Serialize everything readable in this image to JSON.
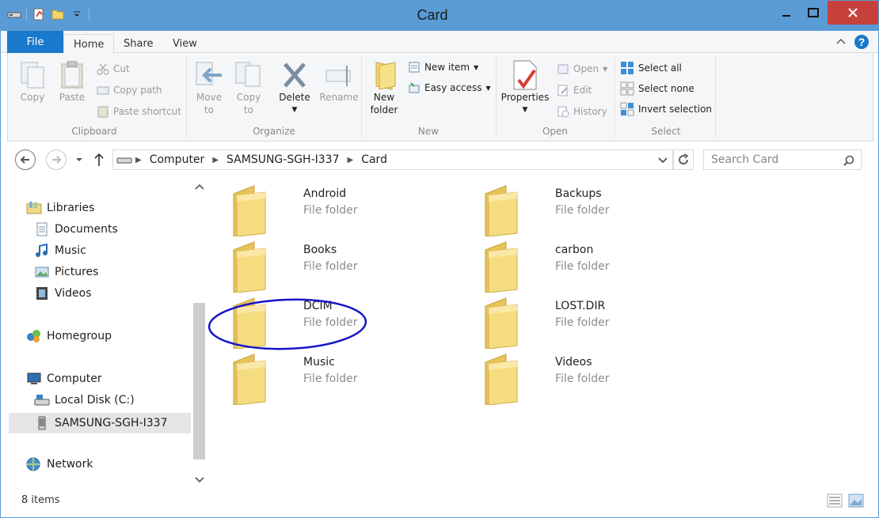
{
  "window": {
    "title": "Card"
  },
  "ribbon": {
    "tabs": {
      "file": "File",
      "home": "Home",
      "share": "Share",
      "view": "View"
    },
    "clipboard": {
      "label": "Clipboard",
      "copy": "Copy",
      "paste": "Paste",
      "cut": "Cut",
      "copy_path": "Copy path",
      "paste_shortcut": "Paste shortcut"
    },
    "organize": {
      "label": "Organize",
      "move_to_1": "Move",
      "move_to_2": "to",
      "copy_to_1": "Copy",
      "copy_to_2": "to",
      "delete": "Delete",
      "rename": "Rename"
    },
    "new": {
      "label": "New",
      "new_folder_1": "New",
      "new_folder_2": "folder",
      "new_item": "New item",
      "easy_access": "Easy access"
    },
    "open": {
      "label": "Open",
      "properties": "Properties",
      "open": "Open",
      "edit": "Edit",
      "history": "History"
    },
    "select": {
      "label": "Select",
      "select_all": "Select all",
      "select_none": "Select none",
      "invert_selection": "Invert selection"
    }
  },
  "address": {
    "crumbs": [
      "Computer",
      "SAMSUNG-SGH-I337",
      "Card"
    ],
    "search_placeholder": "Search Card"
  },
  "nav": {
    "libraries": "Libraries",
    "documents": "Documents",
    "music": "Music",
    "pictures": "Pictures",
    "videos": "Videos",
    "homegroup": "Homegroup",
    "computer": "Computer",
    "local_disk": "Local Disk (C:)",
    "samsung": "SAMSUNG-SGH-I337",
    "network": "Network"
  },
  "files": [
    {
      "name": "Android",
      "type": "File folder"
    },
    {
      "name": "Backups",
      "type": "File folder"
    },
    {
      "name": "Books",
      "type": "File folder"
    },
    {
      "name": "carbon",
      "type": "File folder"
    },
    {
      "name": "DCIM",
      "type": "File folder",
      "annotated": true
    },
    {
      "name": "LOST.DIR",
      "type": "File folder"
    },
    {
      "name": "Music",
      "type": "File folder"
    },
    {
      "name": "Videos",
      "type": "File folder"
    }
  ],
  "status": {
    "item_count": "8 items"
  },
  "colors": {
    "titlebar": "#5a9bd5",
    "file_tab": "#1979ca",
    "close": "#c7413b",
    "annotation": "#1515c8",
    "folder": "#f3d66e"
  }
}
